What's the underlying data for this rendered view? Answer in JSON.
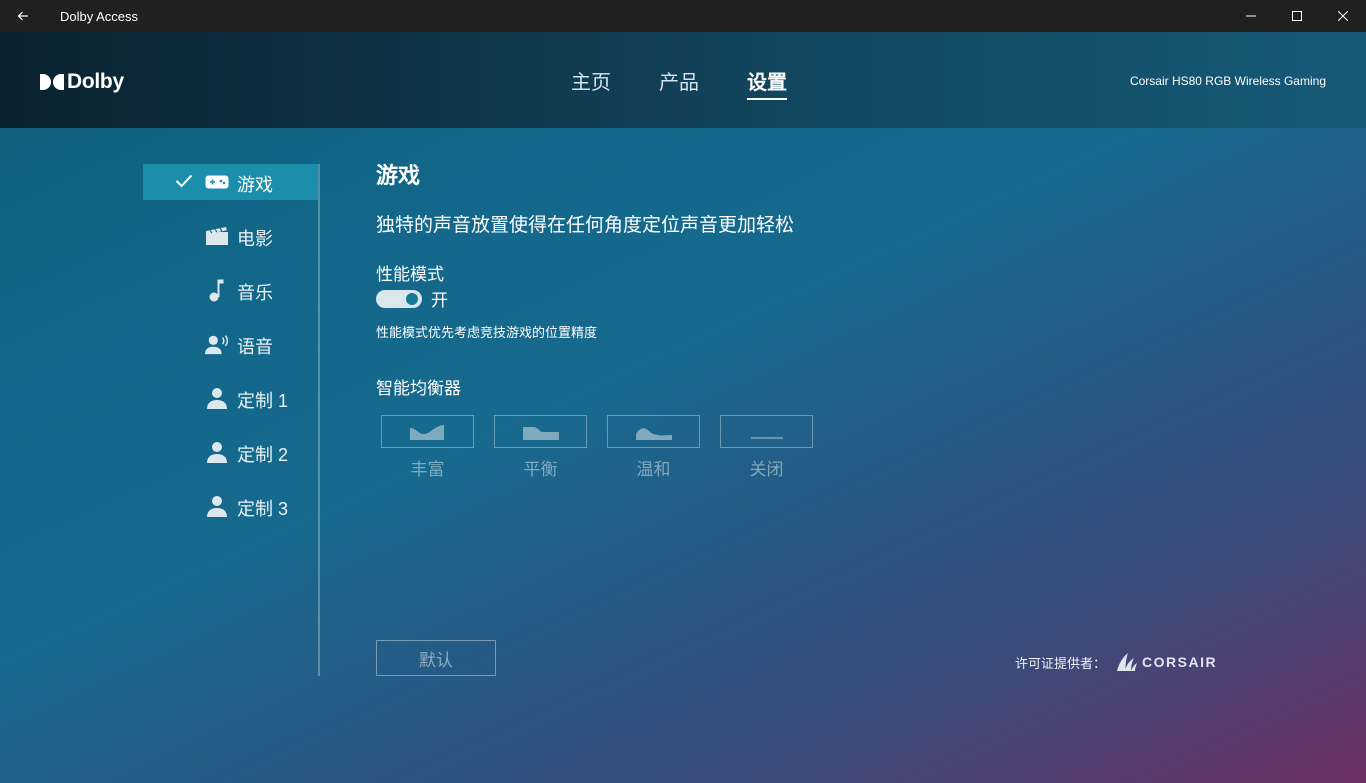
{
  "window": {
    "title": "Dolby Access"
  },
  "header": {
    "brand": "Dolby",
    "nav": [
      {
        "label": "主页"
      },
      {
        "label": "产品"
      },
      {
        "label": "设置"
      }
    ],
    "device_name": "Corsair HS80 RGB Wireless Gaming"
  },
  "sidebar": {
    "items": [
      {
        "label": "游戏",
        "icon": "gamepad-icon",
        "active": true
      },
      {
        "label": "电影",
        "icon": "clapperboard-icon"
      },
      {
        "label": "音乐",
        "icon": "music-note-icon"
      },
      {
        "label": "语音",
        "icon": "voice-icon"
      },
      {
        "label": "定制 1",
        "icon": "user-icon"
      },
      {
        "label": "定制 2",
        "icon": "user-icon"
      },
      {
        "label": "定制 3",
        "icon": "user-icon"
      }
    ]
  },
  "content": {
    "title": "游戏",
    "subtitle": "独特的声音放置使得在任何角度定位声音更加轻松",
    "performance_mode": {
      "label": "性能模式",
      "state": "开",
      "enabled": true,
      "description": "性能模式优先考虑竞技游戏的位置精度"
    },
    "equalizer": {
      "label": "智能均衡器",
      "options": [
        {
          "label": "丰富",
          "icon": "eq-rich-icon"
        },
        {
          "label": "平衡",
          "icon": "eq-balanced-icon"
        },
        {
          "label": "温和",
          "icon": "eq-warm-icon"
        },
        {
          "label": "关闭",
          "icon": "eq-off-icon"
        }
      ]
    },
    "default_button": "默认"
  },
  "footer": {
    "license_label": "许可证提供者：",
    "license_brand": "CORSAIR"
  },
  "colors": {
    "active_tab": "#1a8eaa",
    "toggle_knob": "#157a97",
    "titlebar": "#202020"
  }
}
